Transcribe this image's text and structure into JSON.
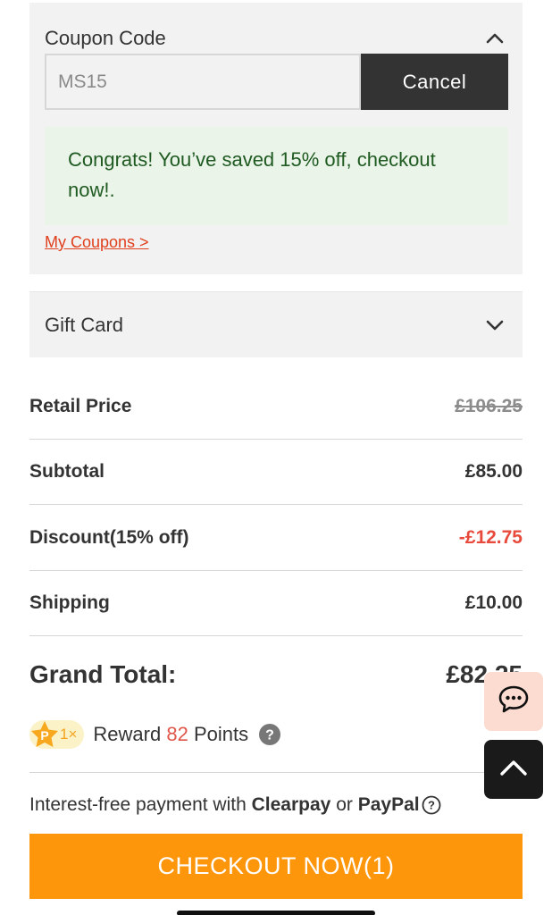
{
  "coupon": {
    "title": "Coupon Code",
    "input_value": "MS15",
    "cancel_label": "Cancel",
    "success_message": "Congrats! You’ve saved 15% off, checkout now!.",
    "my_coupons_link": "My Coupons >"
  },
  "gift_card": {
    "title": "Gift Card"
  },
  "summary": {
    "retail_price_label": "Retail Price",
    "retail_price_value": "£106.25",
    "subtotal_label": "Subtotal",
    "subtotal_value": "£85.00",
    "discount_label": "Discount(15% off)",
    "discount_value": "-£12.75",
    "shipping_label": "Shipping",
    "shipping_value": "£10.00",
    "grand_total_label": "Grand Total:",
    "grand_total_value": "£82.25"
  },
  "reward": {
    "badge_letter": "P",
    "multiplier": "1×",
    "prefix": "Reward",
    "points": "82",
    "suffix": "Points"
  },
  "payment": {
    "prefix": "Interest-free payment with",
    "provider1": "Clearpay",
    "joiner": "or",
    "provider2": "PayPal"
  },
  "checkout": {
    "label": "CHECKOUT NOW(1)"
  },
  "icons": {
    "coupon_toggle": "chevron-up-icon",
    "gift_toggle": "chevron-down-icon",
    "help": "question-circle-icon",
    "chat": "chat-bubble-icon",
    "back_to_top": "arrow-up-icon"
  },
  "colors": {
    "accent_orange": "#fd960b",
    "discount_red": "#e84a3c",
    "link_red": "#e0401e",
    "success_bg": "#eaf4e9",
    "success_text": "#1f5a21",
    "cancel_bg": "#333333"
  }
}
